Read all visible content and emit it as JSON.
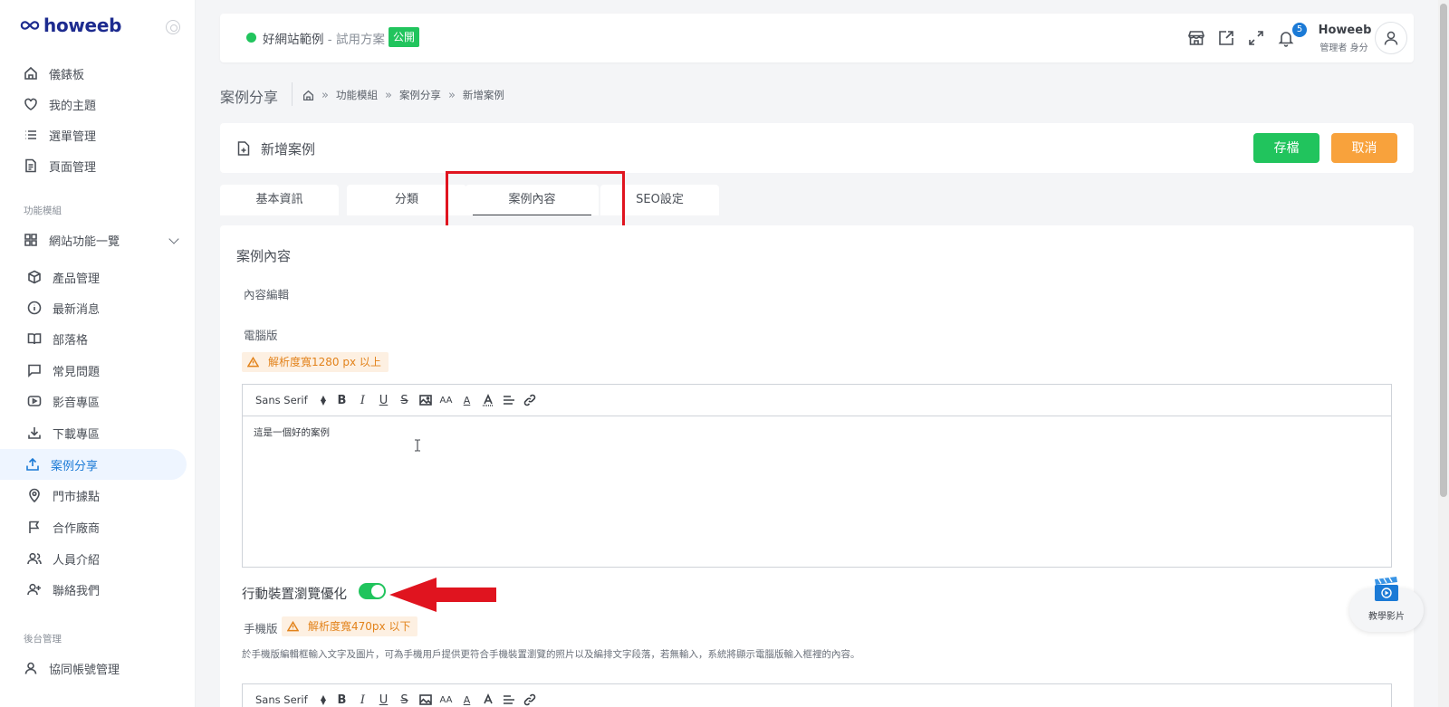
{
  "brand": {
    "logo_text": "howeeb",
    "accent": "#1b7ad6",
    "green": "#21c45d",
    "orange": "#f8a23c"
  },
  "sidebar": {
    "items_top": [
      {
        "label": "儀錶板",
        "icon": "home-icon"
      },
      {
        "label": "我的主題",
        "icon": "heart-icon"
      },
      {
        "label": "選單管理",
        "icon": "list-icon"
      },
      {
        "label": "頁面管理",
        "icon": "document-icon"
      }
    ],
    "section_modules": "功能模組",
    "group_label": "網站功能一覽",
    "items_modules": [
      {
        "label": "產品管理",
        "icon": "box-icon"
      },
      {
        "label": "最新消息",
        "icon": "info-icon"
      },
      {
        "label": "部落格",
        "icon": "book-icon"
      },
      {
        "label": "常見問題",
        "icon": "chat-icon"
      },
      {
        "label": "影音專區",
        "icon": "video-icon"
      },
      {
        "label": "下載專區",
        "icon": "download-icon"
      },
      {
        "label": "案例分享",
        "icon": "share-icon",
        "active": true
      },
      {
        "label": "門市據點",
        "icon": "map-pin-icon"
      },
      {
        "label": "合作廠商",
        "icon": "flag-icon"
      },
      {
        "label": "人員介紹",
        "icon": "users-icon"
      },
      {
        "label": "聯絡我們",
        "icon": "user-plus-icon"
      }
    ],
    "section_backend": "後台管理",
    "items_backend": [
      {
        "label": "協同帳號管理",
        "icon": "user-icon"
      }
    ]
  },
  "topbar": {
    "site_name": "好網站範例",
    "site_plan": " - 試用方案",
    "public_badge": "公開",
    "notification_count": "5",
    "user_name": "Howeeb",
    "user_role": "管理者 身分"
  },
  "breadcrumb": {
    "page_title": "案例分享",
    "items": [
      "功能模組",
      "案例分享",
      "新增案例"
    ],
    "sep": "»"
  },
  "header": {
    "title": "新增案例",
    "save_label": "存檔",
    "cancel_label": "取消"
  },
  "tabs": [
    "基本資訊",
    "分類",
    "案例內容",
    "SEO設定"
  ],
  "content": {
    "section_title": "案例內容",
    "edit_label": "內容編輯",
    "desktop_label": "電腦版",
    "desktop_warning": "解析度寬1280 px 以上",
    "font_name": "Sans Serif",
    "editor_text": "這是一個好的案例",
    "mobile_toggle_label": "行動裝置瀏覽優化",
    "mobile_toggle_on": true,
    "mobile_label": "手機版",
    "mobile_warning": "解析度寬470px 以下",
    "mobile_hint": "於手機版編輯框輸入文字及圖片，可為手機用戶提供更符合手機裝置瀏覽的照片以及編排文字段落，若無輸入，系統將顯示電腦版輸入框裡的內容。"
  },
  "help_widget": {
    "label": "教學影片"
  }
}
